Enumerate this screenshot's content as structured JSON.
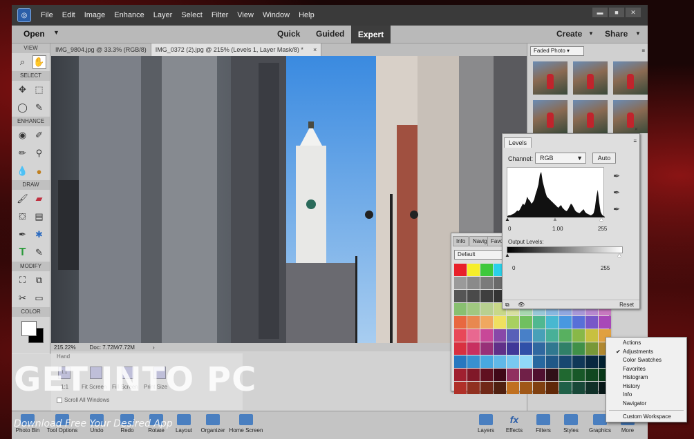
{
  "menu": [
    "File",
    "Edit",
    "Image",
    "Enhance",
    "Layer",
    "Select",
    "Filter",
    "View",
    "Window",
    "Help"
  ],
  "window_controls": {
    "minimize": "▬",
    "maximize": "■",
    "close": "✕"
  },
  "modebar": {
    "open": "Open",
    "modes": [
      "Quick",
      "Guided",
      "Expert"
    ],
    "active_mode": "Expert",
    "create": "Create",
    "share": "Share"
  },
  "toolbox": {
    "sections": [
      "VIEW",
      "SELECT",
      "ENHANCE",
      "DRAW",
      "MODIFY",
      "COLOR"
    ]
  },
  "tabs": [
    {
      "label": "IMG_9804.jpg @ 33.3% (RGB/8)",
      "active": false
    },
    {
      "label": "IMG_0372 (2).jpg @ 215% (Levels 1, Layer Mask/8) *",
      "active": true,
      "close": "×"
    }
  ],
  "status": {
    "zoom": "215.22%",
    "doc": "Doc: 7.72M/7.72M"
  },
  "tool_options": {
    "tool_name": "Hand",
    "buttons": [
      "1:1",
      "Fit Screen",
      "Fill Screen",
      "Print Size"
    ],
    "scroll_all": "Scroll All Windows"
  },
  "taskbar": {
    "left": [
      "Photo Bin",
      "Tool Options",
      "Undo",
      "Redo",
      "Rotate",
      "Layout",
      "Organizer",
      "Home Screen"
    ],
    "right": [
      "Layers",
      "Effects",
      "Filters",
      "Styles",
      "Graphics",
      "More"
    ]
  },
  "effects_panel": {
    "selected": "Faded Photo"
  },
  "levels": {
    "tab": "Levels",
    "channel_label": "Channel:",
    "channel": "RGB",
    "auto": "Auto",
    "input_black": "0",
    "input_mid": "1.00",
    "input_white": "255",
    "output_label": "Output Levels:",
    "output_black": "0",
    "output_white": "255",
    "reset": "Reset"
  },
  "swatches_panel": {
    "tabs": [
      "Info",
      "Navig",
      "Favo"
    ],
    "selected": "Default"
  },
  "swatch_colors": [
    "#e8202a",
    "#f6ee2a",
    "#3ec83c",
    "#2ad0e8",
    "#3c5ce0",
    "#c83ce0",
    "#e8e8e8",
    "#c8c8c8",
    "#a8a8a8",
    "#888888",
    "#686868",
    "#484848",
    "#9a9a9a",
    "#8a8a8a",
    "#7a7a7a",
    "#6a6a6a",
    "#5a5a5a",
    "#4a4a4a",
    "#3a3a3a",
    "#2a2a2a",
    "#1a1a1a",
    "#101010",
    "#0a0a0a",
    "#000000",
    "#555555",
    "#4a4a4a",
    "#3f3f3f",
    "#343434",
    "#2a2a2a",
    "#202020",
    "#d8c8c0",
    "#e0b8b0",
    "#d8a0a8",
    "#e8a0b8",
    "#e890a8",
    "#e880a0",
    "#88c070",
    "#a0c880",
    "#b8d090",
    "#c8d888",
    "#d8e0a0",
    "#a8d8b0",
    "#98c8d8",
    "#88b8e0",
    "#90a8e0",
    "#a898d8",
    "#b888d0",
    "#c878c0",
    "#e86840",
    "#e88850",
    "#f0a860",
    "#f0e060",
    "#a8d060",
    "#70c060",
    "#50b890",
    "#48b8d0",
    "#4898e0",
    "#5870d8",
    "#7858c8",
    "#a848b8",
    "#e84858",
    "#e86890",
    "#c84898",
    "#8848a8",
    "#5860b8",
    "#4880c8",
    "#48a0b8",
    "#48b098",
    "#58b060",
    "#88b848",
    "#c8c040",
    "#e0a040",
    "#d83040",
    "#c83060",
    "#983078",
    "#603088",
    "#403898",
    "#3050a8",
    "#3068a0",
    "#307890",
    "#308068",
    "#409048",
    "#789838",
    "#b08830",
    "#2878c0",
    "#3890d0",
    "#48a8e0",
    "#60b8e8",
    "#78c8f0",
    "#90d8f8",
    "#2868a0",
    "#205888",
    "#184870",
    "#103858",
    "#082840",
    "#002030",
    "#a02030",
    "#801828",
    "#601020",
    "#400818",
    "#903060",
    "#702048",
    "#501030",
    "#301018",
    "#206830",
    "#185828",
    "#104820",
    "#083818",
    "#b03028",
    "#903020",
    "#702818",
    "#502010",
    "#c07020",
    "#a05818",
    "#804010",
    "#602808",
    "#206048",
    "#184838",
    "#103028",
    "#081818"
  ],
  "context_menu": {
    "items": [
      "Actions",
      "Adjustments",
      "Color Swatches",
      "Favorites",
      "Histogram",
      "History",
      "Info",
      "Navigator"
    ],
    "checked": "Adjustments",
    "custom": "Custom Workspace"
  },
  "watermark": {
    "title": "GET INTO PC",
    "subtitle": "Download Free Your Desired App"
  },
  "histogram": [
    2,
    3,
    3,
    4,
    5,
    6,
    8,
    10,
    9,
    12,
    16,
    20,
    18,
    22,
    30,
    26,
    24,
    20,
    22,
    26,
    34,
    40,
    48,
    62,
    66,
    52,
    44,
    36,
    30,
    28,
    26,
    24,
    22,
    20,
    18,
    16,
    14,
    16,
    18,
    14,
    12,
    10,
    9,
    12,
    16,
    20,
    18,
    14,
    10,
    8,
    7,
    6,
    8,
    10,
    12,
    8,
    6,
    5,
    4,
    3,
    4,
    6,
    14,
    30,
    40,
    22,
    8,
    4,
    2,
    1
  ],
  "colors": {
    "expert_bg": "#3d3d3d",
    "menubar": "#3a3a3a"
  }
}
